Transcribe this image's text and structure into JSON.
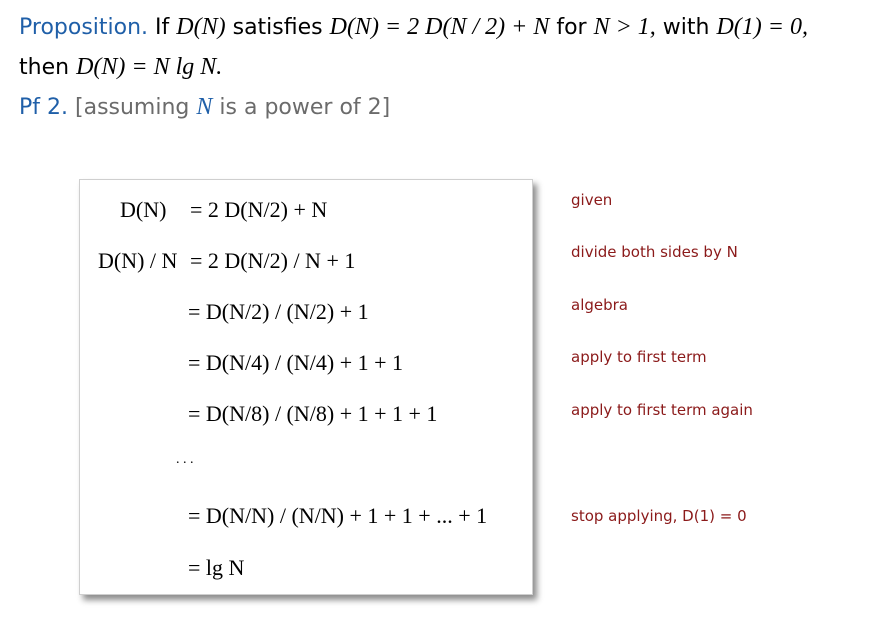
{
  "header": {
    "proposition_label": "Proposition.",
    "line1_text_a": "If",
    "line1_math_a": "D(N)",
    "line1_text_b": "satisfies",
    "line1_math_b": "D(N) = 2 D(N / 2) + N",
    "line1_text_c": "for",
    "line1_math_c": "N > 1,",
    "line1_text_d": "with",
    "line1_math_d": "D(1) = 0,",
    "line2_text": "then",
    "line2_math": "D(N) = N lg N.",
    "pf_label": "Pf 2.",
    "pf_text_a": "[assuming",
    "pf_math": "N",
    "pf_text_b": "is a power of 2]"
  },
  "steps": [
    {
      "lhs": "D(N)",
      "rhs": "=  2 D(N/2)  +  N",
      "note": "given"
    },
    {
      "lhs": "D(N) / N",
      "rhs": "=  2 D(N/2) / N  +  1",
      "note": "divide both sides by N"
    },
    {
      "lhs": "",
      "rhs": "=  D(N/2) / (N/2)  +  1",
      "note": "algebra"
    },
    {
      "lhs": "",
      "rhs": "=  D(N/4) / (N/4)  +  1  +  1",
      "note": "apply to first term"
    },
    {
      "lhs": "",
      "rhs": "=  D(N/8) / (N/8)  +  1  +  1  +  1",
      "note": "apply to first term again"
    },
    {
      "lhs": "",
      "rhs": ". . .",
      "note": ""
    },
    {
      "lhs": "",
      "rhs": "=  D(N/N) / (N/N) +  1 + 1  + ... +  1",
      "note": "stop applying, D(1) = 0"
    },
    {
      "lhs": "",
      "rhs": "=  lg N",
      "note": ""
    }
  ]
}
